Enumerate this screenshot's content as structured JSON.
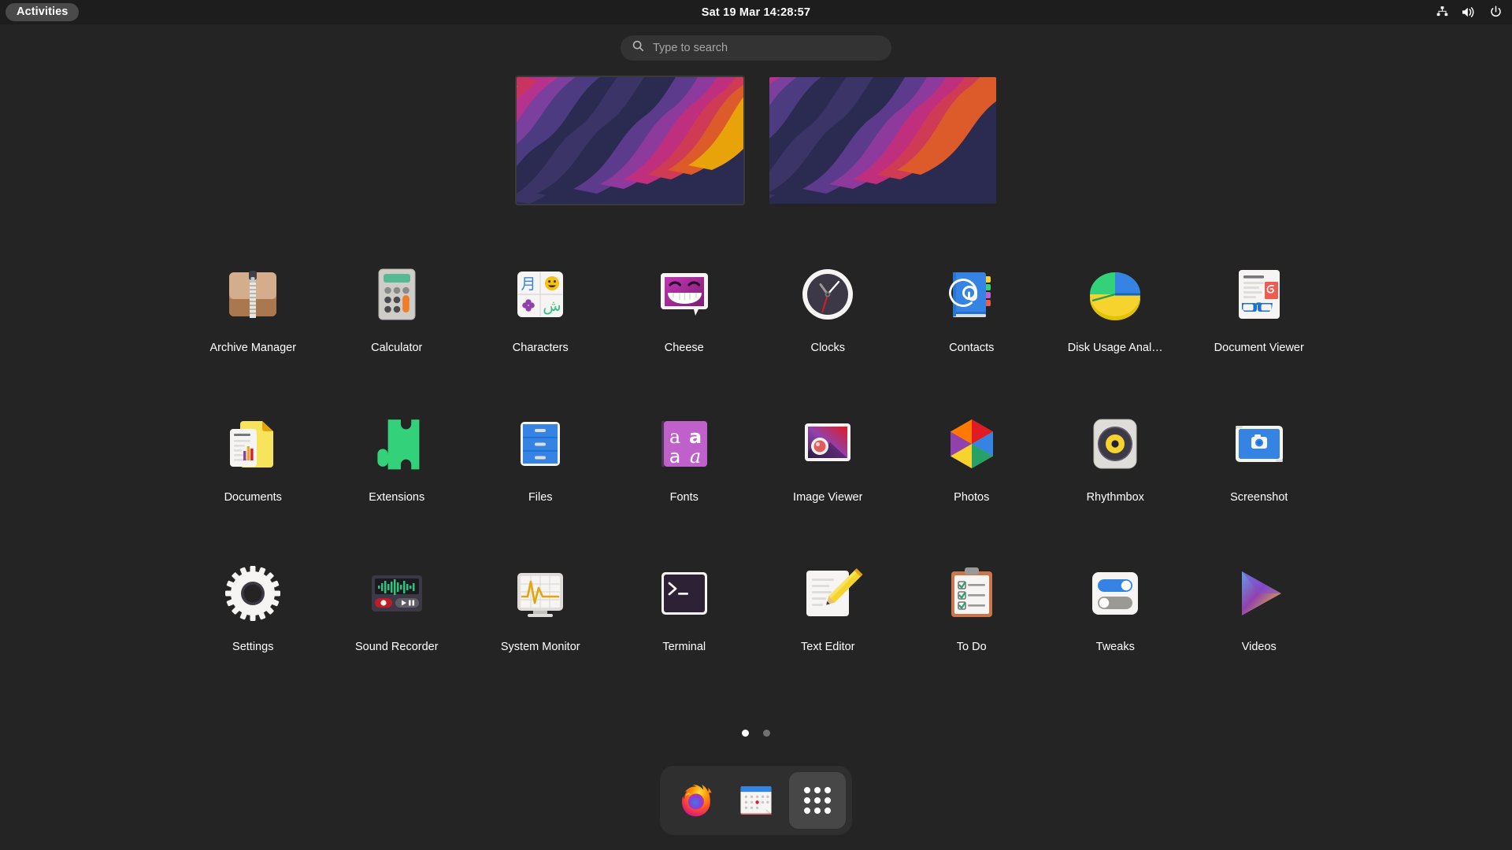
{
  "top_bar": {
    "activities_label": "Activities",
    "clock": "Sat 19 Mar  14:28:57",
    "system_icons": [
      {
        "name": "network-wired-icon",
        "label": "Network"
      },
      {
        "name": "volume-icon",
        "label": "Volume"
      },
      {
        "name": "power-icon",
        "label": "Power"
      }
    ]
  },
  "search": {
    "placeholder": "Type to search",
    "value": "",
    "icon": "search-icon"
  },
  "workspaces": [
    {
      "name": "workspace-1",
      "active": true
    },
    {
      "name": "workspace-2",
      "active": false
    }
  ],
  "apps": [
    {
      "label": "Archive Manager",
      "icon": "archive-manager-icon"
    },
    {
      "label": "Calculator",
      "icon": "calculator-icon"
    },
    {
      "label": "Characters",
      "icon": "characters-icon"
    },
    {
      "label": "Cheese",
      "icon": "cheese-icon"
    },
    {
      "label": "Clocks",
      "icon": "clocks-icon"
    },
    {
      "label": "Contacts",
      "icon": "contacts-icon"
    },
    {
      "label": "Disk Usage Anal…",
      "icon": "disk-usage-analyzer-icon"
    },
    {
      "label": "Document Viewer",
      "icon": "document-viewer-icon"
    },
    {
      "label": "Documents",
      "icon": "documents-icon"
    },
    {
      "label": "Extensions",
      "icon": "extensions-icon"
    },
    {
      "label": "Files",
      "icon": "files-icon"
    },
    {
      "label": "Fonts",
      "icon": "fonts-icon"
    },
    {
      "label": "Image Viewer",
      "icon": "image-viewer-icon"
    },
    {
      "label": "Photos",
      "icon": "photos-icon"
    },
    {
      "label": "Rhythmbox",
      "icon": "rhythmbox-icon"
    },
    {
      "label": "Screenshot",
      "icon": "screenshot-icon"
    },
    {
      "label": "Settings",
      "icon": "settings-icon"
    },
    {
      "label": "Sound Recorder",
      "icon": "sound-recorder-icon"
    },
    {
      "label": "System Monitor",
      "icon": "system-monitor-icon"
    },
    {
      "label": "Terminal",
      "icon": "terminal-icon"
    },
    {
      "label": "Text Editor",
      "icon": "text-editor-icon"
    },
    {
      "label": "To Do",
      "icon": "todo-icon"
    },
    {
      "label": "Tweaks",
      "icon": "tweaks-icon"
    },
    {
      "label": "Videos",
      "icon": "videos-icon"
    }
  ],
  "characters_icon_glyphs": [
    "月",
    "😀",
    "✤",
    "ش"
  ],
  "fonts_icon_glyphs": [
    "a",
    "a",
    "a",
    "a"
  ],
  "pages": {
    "count": 2,
    "current": 1
  },
  "dash": [
    {
      "label": "Firefox",
      "icon": "firefox-icon",
      "active": false
    },
    {
      "label": "Calendar",
      "icon": "calendar-icon",
      "active": false
    },
    {
      "label": "Show Applications",
      "icon": "app-grid-icon",
      "active": true
    }
  ],
  "colors": {
    "bg": "#242424",
    "top_bar_bg": "#1d1d1d",
    "search_bg": "#333333",
    "dash_bg": "#2f2f2f",
    "accent": "#3584e4",
    "text": "#ffffff"
  }
}
